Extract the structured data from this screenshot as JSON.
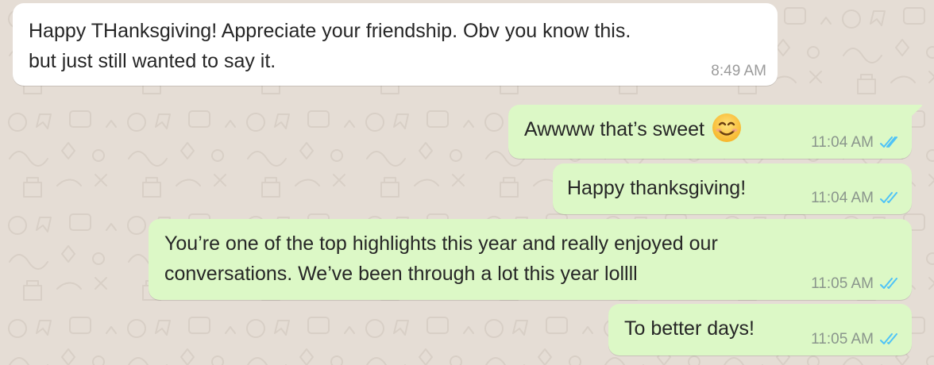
{
  "chat": {
    "messages": [
      {
        "direction": "incoming",
        "lines": [
          "Happy THanksgiving! Appreciate your friendship. Obv you know this.",
          "but just still wanted to say it."
        ],
        "time": "8:49 AM"
      },
      {
        "direction": "outgoing",
        "lines": [
          "Awwww that’s sweet"
        ],
        "emoji": "smiling-face-emoji",
        "time": "11:04 AM",
        "status": "read"
      },
      {
        "direction": "outgoing",
        "lines": [
          "Happy thanksgiving!"
        ],
        "time": "11:04 AM",
        "status": "read"
      },
      {
        "direction": "outgoing",
        "lines": [
          "You’re one of the top highlights this year and really enjoyed our",
          "conversations. We’ve been through a lot this year lollll"
        ],
        "time": "11:05 AM",
        "status": "read"
      },
      {
        "direction": "outgoing",
        "lines": [
          "To better days!"
        ],
        "time": "11:05 AM",
        "status": "read"
      }
    ]
  },
  "colors": {
    "wallpaper": "#e5ddd5",
    "incoming_bubble": "#ffffff",
    "outgoing_bubble": "#dcf8c6",
    "read_ticks": "#4fc3f7",
    "timestamp": "#8a958c"
  },
  "icons": {
    "status": "double-check-icon",
    "emoji": "smiling-face-emoji"
  }
}
